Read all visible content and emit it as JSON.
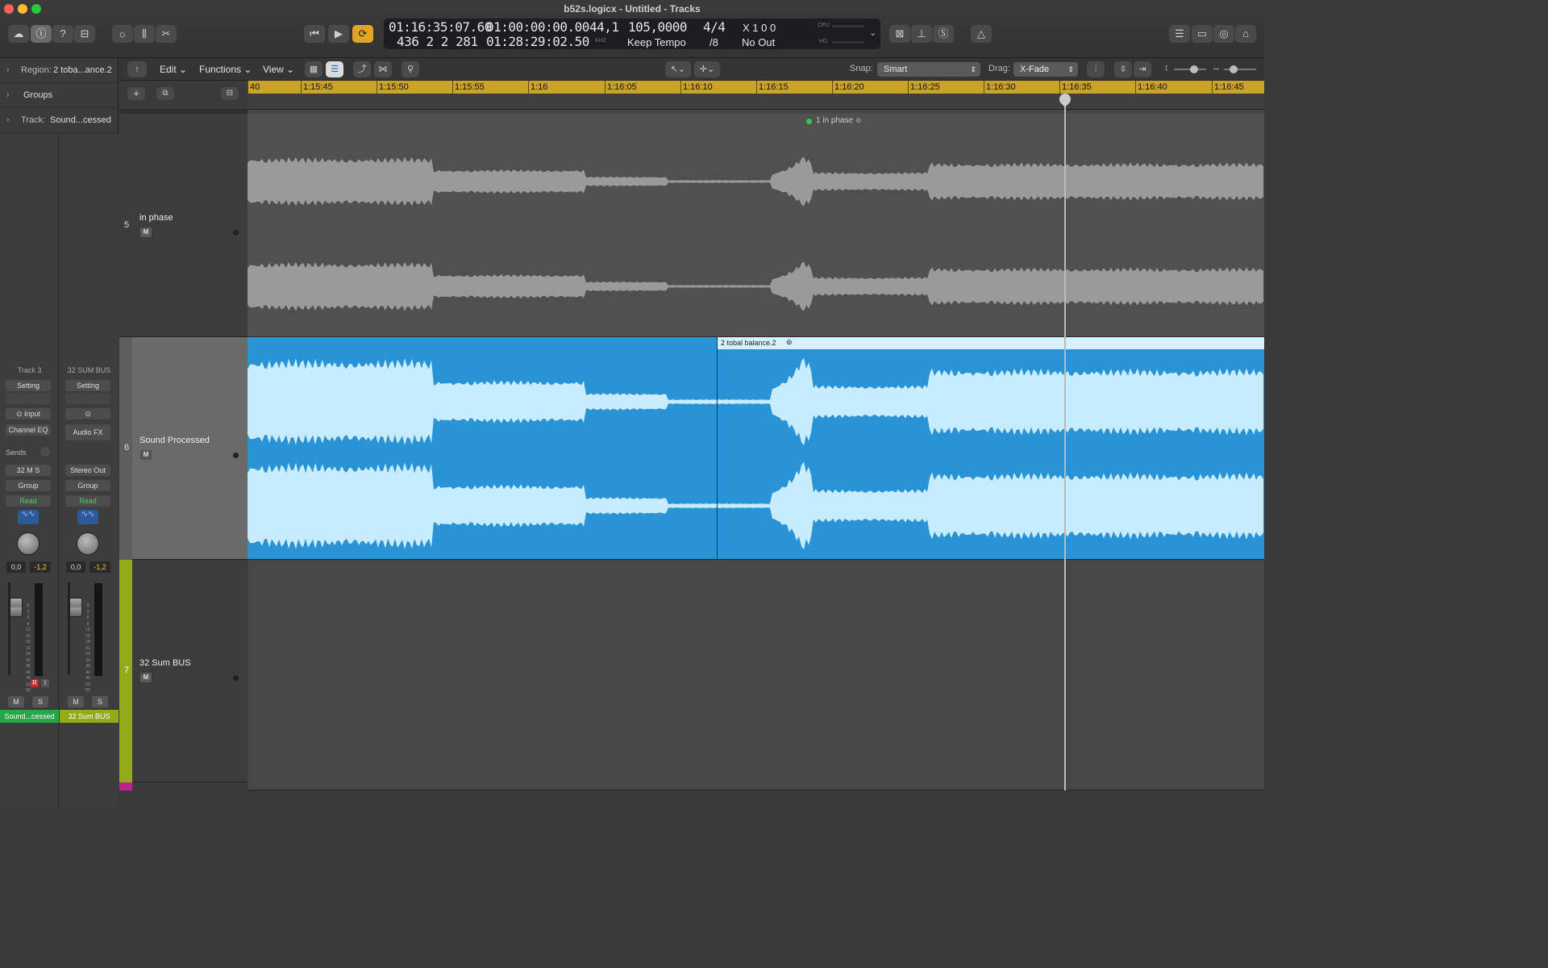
{
  "window": {
    "title": "b52s.logicx - Untitled - Tracks"
  },
  "lcd": {
    "smpte": "01:16:35:07.60",
    "bars": "436  2  2  281",
    "start_time": "01:00:00:00.00",
    "end_time": "01:28:29:02.50",
    "sample_rate": "44,1",
    "khz": "KHZ",
    "tempo": "105,0000",
    "tempo_mode": "Keep Tempo",
    "sig_top": "4/4",
    "sig_bottom": "/8",
    "key_cmd": "X  1  0  0",
    "output": "No Out",
    "cpu": "CPU",
    "hd": "HD"
  },
  "inspector": {
    "region_label": "Region:",
    "region_name": "2 toba...ance.2",
    "groups": "Groups",
    "track_label": "Track:",
    "track_name": "Sound...cessed"
  },
  "strips": [
    {
      "name": "Track 3",
      "setting": "Setting",
      "input": "Input",
      "eq": "Channel EQ",
      "sends": "Sends",
      "output": "32 M S",
      "group": "Group",
      "auto": "Read",
      "vol": "0,0",
      "peak": "-1,2",
      "m": "M",
      "s": "S",
      "r": "R",
      "i": "I",
      "label": "Sound...cessed",
      "color": "#27a64a"
    },
    {
      "name": "32 SUM BUS",
      "setting": "Setting",
      "input": "",
      "eq": "Audio FX",
      "sends": "",
      "output": "Stereo Out",
      "group": "Group",
      "auto": "Read",
      "vol": "0,0",
      "peak": "-1,2",
      "m": "M",
      "s": "S",
      "label": "32 Sum BUS",
      "color": "#93ab19"
    }
  ],
  "meter_scale": [
    "0",
    "3",
    "6",
    "9",
    "12",
    "15",
    "18",
    "21",
    "24",
    "30",
    "35",
    "40",
    "45",
    "50",
    "60"
  ],
  "toolbar": {
    "edit": "Edit",
    "functions": "Functions",
    "view": "View",
    "snap_label": "Snap:",
    "snap_value": "Smart",
    "drag_label": "Drag:",
    "drag_value": "X-Fade"
  },
  "ruler": [
    "40",
    "1:15:45",
    "1:15:50",
    "1:15:55",
    "1:16",
    "1:16:05",
    "1:16:10",
    "1:16:15",
    "1:16:20",
    "1:16:25",
    "1:16:30",
    "1:16:35",
    "1:16:40",
    "1:16:45"
  ],
  "tracks": [
    {
      "num": "5",
      "name": "in phase",
      "m": "M"
    },
    {
      "num": "6",
      "name": "Sound Processed",
      "m": "M"
    },
    {
      "num": "7",
      "name": "32 Sum BUS",
      "m": "M"
    }
  ],
  "regions": {
    "in_phase_label": "1 in phase",
    "processed_label": "2 tobal balance.2"
  },
  "colors": {
    "region_blue": "#2a93d5",
    "wave_light": "#c7ecff",
    "ruler_yellow": "#c9a326",
    "loop_orange": "#e0a526"
  }
}
